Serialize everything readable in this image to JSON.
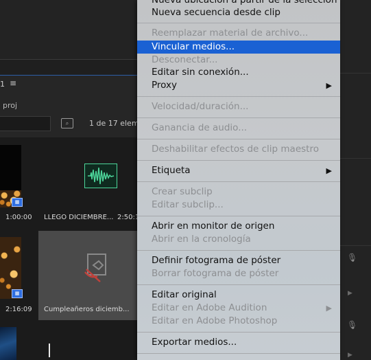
{
  "project_panel": {
    "panel_number": "1",
    "project_name_partial": "proj",
    "item_count": "1 de 17 eleme",
    "clips": [
      {
        "duration": "1:00:00"
      },
      {
        "name": "LLEGO DICIEMBRE...",
        "duration": "2:50:1"
      },
      {
        "duration": "2:16:09"
      },
      {
        "name": "Cumpleañeros diciemb..."
      }
    ]
  },
  "menu": {
    "items": [
      {
        "label": "Nueva ubicación a partir de la selección",
        "enabled": true
      },
      {
        "label": "Nueva secuencia desde clip",
        "enabled": true
      },
      {
        "label": "Reemplazar material de archivo...",
        "enabled": false
      },
      {
        "label": "Vincular medios...",
        "enabled": true,
        "highlighted": true
      },
      {
        "label": "Desconectar...",
        "enabled": false
      },
      {
        "label": "Editar sin conexión...",
        "enabled": true
      },
      {
        "label": "Proxy",
        "enabled": true,
        "submenu": true
      },
      {
        "label": "Velocidad/duración...",
        "enabled": false
      },
      {
        "label": "Ganancia de audio...",
        "enabled": false
      },
      {
        "label": "Deshabilitar efectos de clip maestro",
        "enabled": false
      },
      {
        "label": "Etiqueta",
        "enabled": true,
        "submenu": true
      },
      {
        "label": "Crear subclip",
        "enabled": false
      },
      {
        "label": "Editar subclip...",
        "enabled": false
      },
      {
        "label": "Abrir en monitor de origen",
        "enabled": true
      },
      {
        "label": "Abrir en la cronología",
        "enabled": false
      },
      {
        "label": "Definir fotograma de póster",
        "enabled": true
      },
      {
        "label": "Borrar fotograma de póster",
        "enabled": false
      },
      {
        "label": "Editar original",
        "enabled": true
      },
      {
        "label": "Editar en Adobe Audition",
        "enabled": false,
        "submenu": true
      },
      {
        "label": "Editar en Adobe Photoshop",
        "enabled": false
      },
      {
        "label": "Exportar medios...",
        "enabled": true
      }
    ],
    "submenu_arrow": "▶"
  },
  "colors": {
    "highlight": "#1a61d3",
    "disabled_text": "#8d8f92",
    "audio_waveform": "#4dd79b",
    "badge": "#2f6ee0"
  }
}
